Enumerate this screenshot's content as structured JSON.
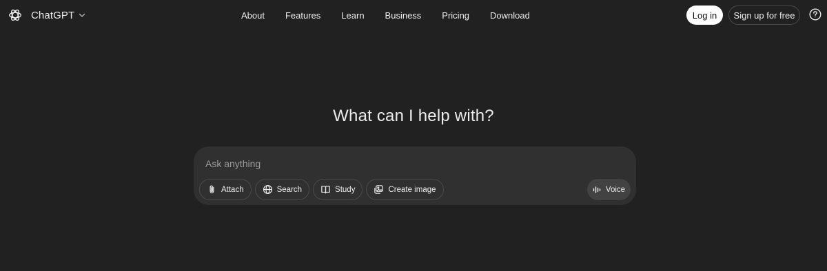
{
  "header": {
    "brand": {
      "name": "ChatGPT",
      "logo_icon": "openai-logo-icon",
      "dropdown_icon": "chevron-down-icon"
    },
    "nav": [
      {
        "label": "About"
      },
      {
        "label": "Features"
      },
      {
        "label": "Learn"
      },
      {
        "label": "Business"
      },
      {
        "label": "Pricing"
      },
      {
        "label": "Download"
      }
    ],
    "login_label": "Log in",
    "signup_label": "Sign up for free",
    "help_icon": "question-circle-icon"
  },
  "main": {
    "title": "What can I help with?",
    "composer": {
      "placeholder": "Ask anything",
      "value": "",
      "tools": [
        {
          "label": "Attach",
          "icon": "paperclip-icon"
        },
        {
          "label": "Search",
          "icon": "globe-icon"
        },
        {
          "label": "Study",
          "icon": "book-icon"
        },
        {
          "label": "Create image",
          "icon": "image-icon"
        }
      ],
      "voice_label": "Voice",
      "voice_icon": "waveform-icon"
    }
  },
  "colors": {
    "background": "#212121",
    "composer_bg": "#303030",
    "text": "#ececec",
    "placeholder": "#9b9b9b",
    "login_bg": "#ffffff",
    "voice_bg": "#424242"
  }
}
